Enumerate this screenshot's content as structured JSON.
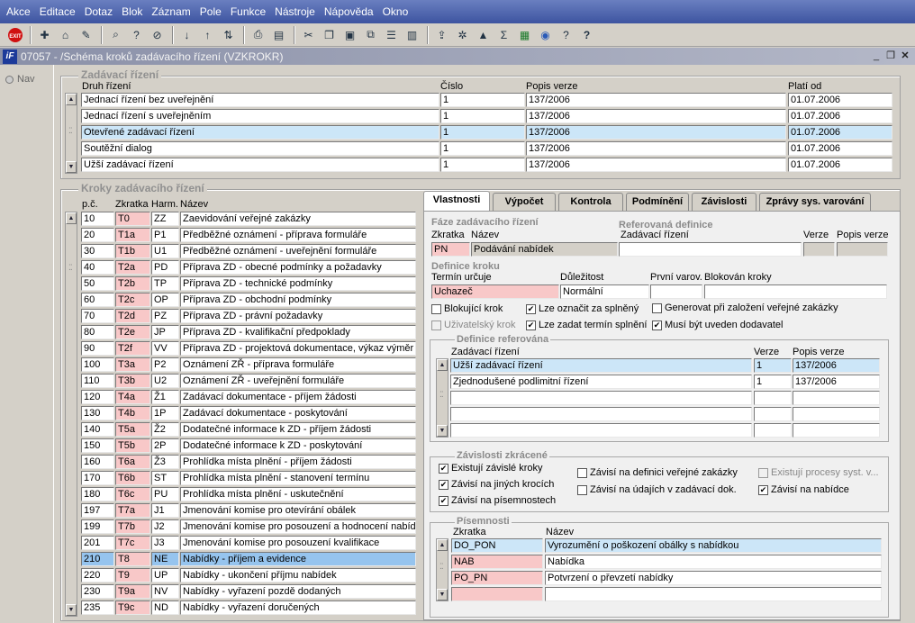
{
  "menu": [
    "Akce",
    "Editace",
    "Dotaz",
    "Blok",
    "Záznam",
    "Pole",
    "Funkce",
    "Nástroje",
    "Nápověda",
    "Okno"
  ],
  "toolbar_icons": [
    "exit-icon",
    "insert-record-icon",
    "lock-record-icon",
    "clear-record-icon",
    "find-icon",
    "query-icon",
    "clear-query-icon",
    "sort-asc-icon",
    "sort-desc-icon",
    "sort-multi-icon",
    "print-icon",
    "print-preview-icon",
    "cut-icon",
    "copy-icon",
    "paste-icon",
    "duplicate-icon",
    "list-icon",
    "columns-icon",
    "export-icon",
    "tools-icon",
    "chart-icon",
    "sum-icon",
    "excel-icon",
    "web-icon",
    "help-context-icon",
    "help-icon"
  ],
  "window": {
    "title": "07057 - /Schéma kroků zadávacího řízení (VZKROKR)",
    "logo": "iF"
  },
  "left": {
    "nav": "Nav"
  },
  "zr": {
    "title": "Zadávací řízení",
    "headers": {
      "druh": "Druh řízení",
      "cislo": "Číslo",
      "popis": "Popis verze",
      "platnost": "Platí od"
    },
    "rows": [
      {
        "druh": "Jednací řízení bez uveřejnění",
        "cislo": "1",
        "popis": "137/2006",
        "platnost": "01.07.2006"
      },
      {
        "druh": "Jednací řízení s uveřejněním",
        "cislo": "1",
        "popis": "137/2006",
        "platnost": "01.07.2006"
      },
      {
        "druh": "Otevřené zadávací řízení",
        "cislo": "1",
        "popis": "137/2006",
        "platnost": "01.07.2006"
      },
      {
        "druh": "Soutěžní dialog",
        "cislo": "1",
        "popis": "137/2006",
        "platnost": "01.07.2006"
      },
      {
        "druh": "Užší zadávací řízení",
        "cislo": "1",
        "popis": "137/2006",
        "platnost": "01.07.2006"
      }
    ]
  },
  "kroky": {
    "title": "Kroky zadávacího řízení",
    "headers": {
      "pc": "p.č.",
      "zkr": "Zkratka",
      "harm": "Harm.",
      "nazev": "Název"
    },
    "rows": [
      {
        "pc": "10",
        "zkr": "T0",
        "harm": "ZZ",
        "nazev": "Zaevidování veřejné zakázky"
      },
      {
        "pc": "20",
        "zkr": "T1a",
        "harm": "P1",
        "nazev": "Předběžné oznámení - příprava formuláře"
      },
      {
        "pc": "30",
        "zkr": "T1b",
        "harm": "U1",
        "nazev": "Předběžné oznámení - uveřejnění formuláře"
      },
      {
        "pc": "40",
        "zkr": "T2a",
        "harm": "PD",
        "nazev": "Příprava ZD - obecné podmínky a požadavky"
      },
      {
        "pc": "50",
        "zkr": "T2b",
        "harm": "TP",
        "nazev": "Příprava ZD - technické podmínky"
      },
      {
        "pc": "60",
        "zkr": "T2c",
        "harm": "OP",
        "nazev": "Příprava ZD - obchodní podmínky"
      },
      {
        "pc": "70",
        "zkr": "T2d",
        "harm": "PZ",
        "nazev": "Příprava ZD - právní požadavky"
      },
      {
        "pc": "80",
        "zkr": "T2e",
        "harm": "JP",
        "nazev": "Příprava ZD - kvalifikační předpoklady"
      },
      {
        "pc": "90",
        "zkr": "T2f",
        "harm": "VV",
        "nazev": "Příprava ZD - projektová dokumentace, výkaz výměr"
      },
      {
        "pc": "100",
        "zkr": "T3a",
        "harm": "P2",
        "nazev": "Oznámení ZŘ - příprava formuláře"
      },
      {
        "pc": "110",
        "zkr": "T3b",
        "harm": "U2",
        "nazev": "Oznámení ZŘ - uveřejnění formuláře"
      },
      {
        "pc": "120",
        "zkr": "T4a",
        "harm": "Ž1",
        "nazev": "Zadávací dokumentace - příjem žádosti"
      },
      {
        "pc": "130",
        "zkr": "T4b",
        "harm": "1P",
        "nazev": "Zadávací dokumentace - poskytování"
      },
      {
        "pc": "140",
        "zkr": "T5a",
        "harm": "Ž2",
        "nazev": "Dodatečné informace k ZD - příjem žádosti"
      },
      {
        "pc": "150",
        "zkr": "T5b",
        "harm": "2P",
        "nazev": "Dodatečné informace k ZD - poskytování"
      },
      {
        "pc": "160",
        "zkr": "T6a",
        "harm": "Ž3",
        "nazev": "Prohlídka místa plnění - příjem žádosti"
      },
      {
        "pc": "170",
        "zkr": "T6b",
        "harm": "ST",
        "nazev": "Prohlídka místa plnění - stanovení termínu"
      },
      {
        "pc": "180",
        "zkr": "T6c",
        "harm": "PU",
        "nazev": "Prohlídka místa plnění - uskutečnění"
      },
      {
        "pc": "197",
        "zkr": "T7a",
        "harm": "J1",
        "nazev": "Jmenování komise pro otevírání obálek"
      },
      {
        "pc": "199",
        "zkr": "T7b",
        "harm": "J2",
        "nazev": "Jmenování komise pro posouzení a hodnocení nabídek"
      },
      {
        "pc": "201",
        "zkr": "T7c",
        "harm": "J3",
        "nazev": "Jmenování komise pro posouzení kvalifikace"
      },
      {
        "pc": "210",
        "zkr": "T8",
        "harm": "NE",
        "nazev": "Nabídky - příjem a evidence"
      },
      {
        "pc": "220",
        "zkr": "T9",
        "harm": "UP",
        "nazev": "Nabídky - ukončení příjmu nabídek"
      },
      {
        "pc": "230",
        "zkr": "T9a",
        "harm": "NV",
        "nazev": "Nabídky - vyřazení pozdě dodaných"
      },
      {
        "pc": "235",
        "zkr": "T9c",
        "harm": "ND",
        "nazev": "Nabídky - vyřazení doručených"
      }
    ]
  },
  "tabs": [
    "Vlastnosti",
    "Výpočet",
    "Kontrola",
    "Podmínění",
    "Závislosti",
    "Zprávy sys. varování"
  ],
  "props": {
    "faze_title": "Fáze zadávacího řízení",
    "ref_title": "Referovaná definice",
    "faze_zkr_lbl": "Zkratka",
    "faze_naz_lbl": "Název",
    "faze_zkr": "PN",
    "faze_naz": "Podávání nabídek",
    "ref_zr_lbl": "Zadávací řízení",
    "ref_verze_lbl": "Verze",
    "ref_popis_lbl": "Popis verze",
    "def_title": "Definice kroku",
    "termin_lbl": "Termín určuje",
    "termin": "Uchazeč",
    "dul_lbl": "Důležitost",
    "dul": "Normální",
    "prvni_lbl": "První varov.",
    "blok_lbl": "Blokován kroky",
    "checks": [
      {
        "label": "Blokující krok",
        "checked": ""
      },
      {
        "label": "Lze označit za splněný",
        "checked": "✔"
      },
      {
        "label": "Generovat při založení veřejné zakázky",
        "checked": ""
      },
      {
        "label": "Uživatelský krok",
        "checked": ""
      },
      {
        "label": "Lze zadat termín splnění",
        "checked": "✔"
      },
      {
        "label": "Musí být uveden dodavatel",
        "checked": "✔"
      }
    ],
    "defref_title": "Definice referována",
    "defref_headers": {
      "zr": "Zadávací řízení",
      "verze": "Verze",
      "popis": "Popis verze"
    },
    "defref_rows": [
      {
        "zr": "Užší zadávací řízení",
        "verze": "1",
        "popis": "137/2006"
      },
      {
        "zr": "Zjednodušené podlimitní řízení",
        "verze": "1",
        "popis": "137/2006"
      }
    ],
    "zav_title": "Závislosti zkrácené",
    "zav": [
      {
        "label": "Existují závislé kroky",
        "checked": "✔"
      },
      {
        "label": "Závisí na jiných krocích",
        "checked": "✔"
      },
      {
        "label": "Závisí na písemnostech",
        "checked": "✔"
      },
      {
        "label": "Závisí na definici veřejné zakázky",
        "checked": ""
      },
      {
        "label": "Závisí na údajích v zadávací dok.",
        "checked": ""
      },
      {
        "label": "Existují procesy syst. v...",
        "checked": ""
      },
      {
        "label": "Závisí na nabídce",
        "checked": "✔"
      }
    ],
    "pis_title": "Písemnosti",
    "pis_headers": {
      "zkr": "Zkratka",
      "naz": "Název"
    },
    "pis_rows": [
      {
        "zkr": "DO_PON",
        "naz": "Vyrozumění o poškození obálky s nabídkou"
      },
      {
        "zkr": "NAB",
        "naz": "Nabídka"
      },
      {
        "zkr": "PO_PN",
        "naz": "Potvrzení o převzetí nabídky"
      }
    ]
  }
}
